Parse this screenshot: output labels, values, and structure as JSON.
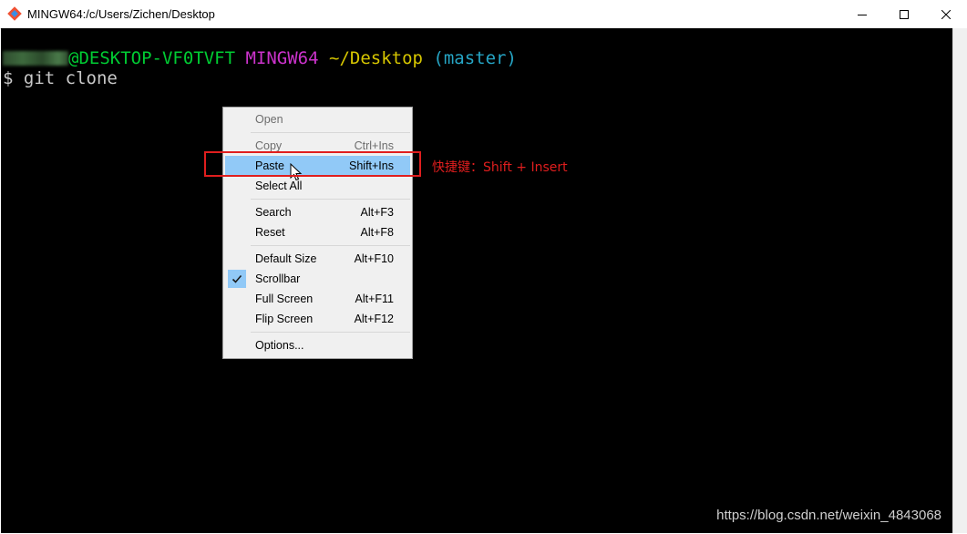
{
  "window": {
    "title": "MINGW64:/c/Users/Zichen/Desktop",
    "icon": "git-bash-icon",
    "controls": [
      "minimize-icon",
      "maximize-icon",
      "close-icon"
    ]
  },
  "terminal": {
    "prompt": {
      "user": "",
      "host": "@DESKTOP-VF0TVFT",
      "system": "MINGW64",
      "path": "~/Desktop",
      "branch": "(master)"
    },
    "command": "$ git clone",
    "colors": {
      "background": "#000000",
      "host": "#00cc33",
      "system": "#cc33cc",
      "path": "#d6c600",
      "branch": "#26a6c6"
    }
  },
  "context_menu": {
    "open": {
      "label": "Open",
      "shortcut": ""
    },
    "copy": {
      "label": "Copy",
      "shortcut": "Ctrl+Ins"
    },
    "paste": {
      "label": "Paste",
      "shortcut": "Shift+Ins"
    },
    "select_all": {
      "label": "Select All",
      "shortcut": ""
    },
    "search": {
      "label": "Search",
      "shortcut": "Alt+F3"
    },
    "reset": {
      "label": "Reset",
      "shortcut": "Alt+F8"
    },
    "default_size": {
      "label": "Default Size",
      "shortcut": "Alt+F10"
    },
    "scrollbar": {
      "label": "Scrollbar",
      "shortcut": "",
      "checked": true
    },
    "full_screen": {
      "label": "Full Screen",
      "shortcut": "Alt+F11"
    },
    "flip_screen": {
      "label": "Flip Screen",
      "shortcut": "Alt+F12"
    },
    "options": {
      "label": "Options...",
      "shortcut": ""
    },
    "highlight_color": "#91c9f7"
  },
  "annotation": {
    "text": "快捷键：Shift + Insert",
    "color": "#e01e1e"
  },
  "watermark": "https://blog.csdn.net/weixin_4843068"
}
